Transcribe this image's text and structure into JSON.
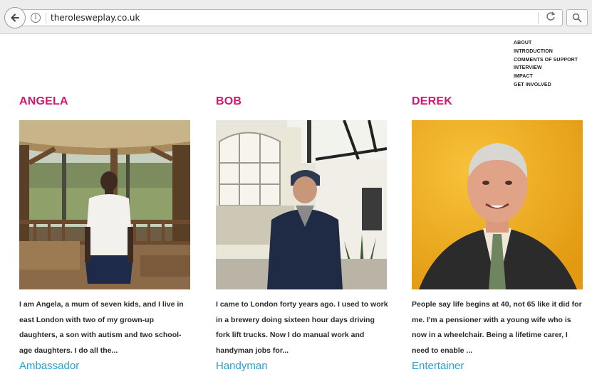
{
  "browser": {
    "url": "therolesweplay.co.uk",
    "info_glyph": "i",
    "reload_glyph": "C"
  },
  "nav": {
    "items": [
      "About",
      "Introduction",
      "Comments of support",
      "Interview",
      "Impact",
      "Get involved"
    ]
  },
  "profiles": [
    {
      "name": "ANGELA",
      "bio": "I am Angela, a mum of seven kids, and I live in east London with two of my grown-up daughters, a son with autism and two school-age daughters. I do all the...",
      "role": "Ambassador"
    },
    {
      "name": "BOB",
      "bio": "I came to London forty years ago. I used to work in a brewery doing sixteen hour days driving fork lift trucks. Now I do manual work and handyman jobs for...",
      "role": "Handyman"
    },
    {
      "name": "DEREK",
      "bio": "People say life begins at 40, not 65 like it did for me. I'm a pensioner with a young wife who is now in a wheelchair. Being a lifetime carer, I need to enable ...",
      "role": "Entertainer"
    }
  ],
  "colors": {
    "name": "#d3166f",
    "role": "#27a0d8"
  }
}
